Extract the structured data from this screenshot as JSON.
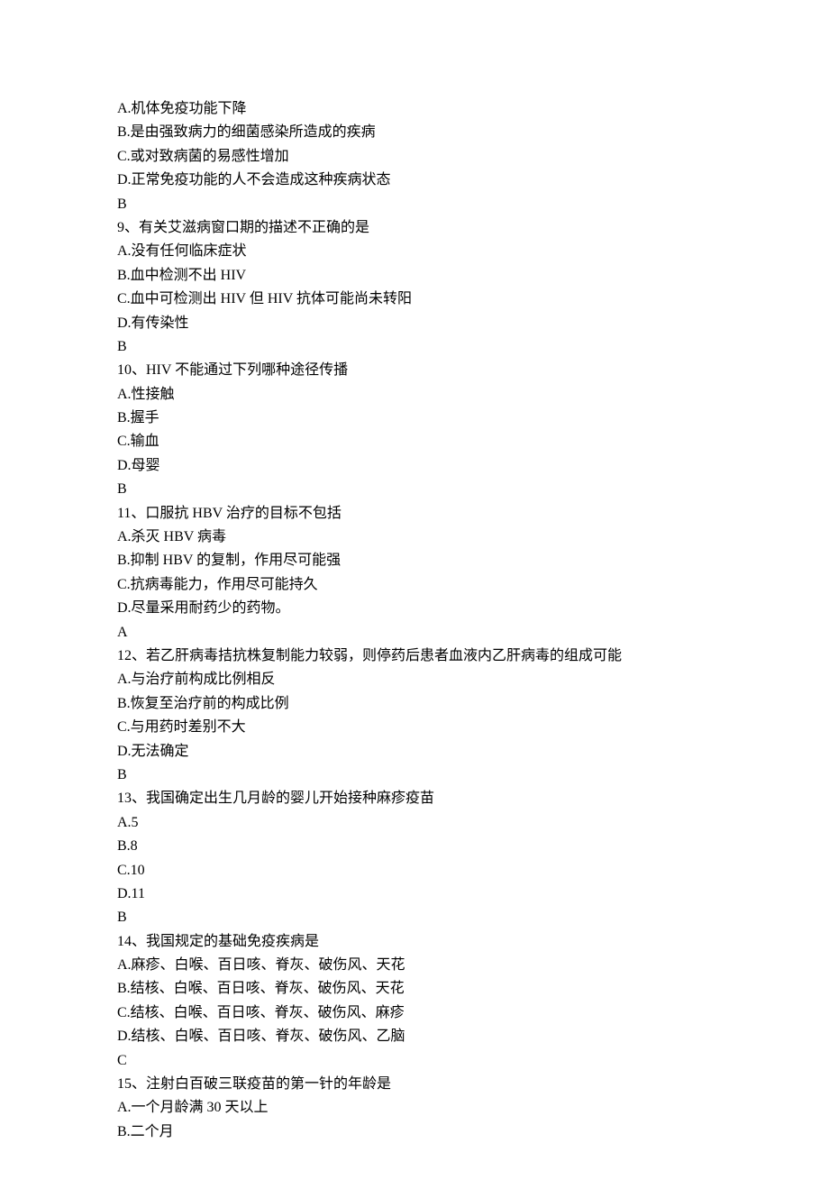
{
  "lines": [
    "A.机体免疫功能下降",
    "B.是由强致病力的细菌感染所造成的疾病",
    "C.或对致病菌的易感性增加",
    "D.正常免疫功能的人不会造成这种疾病状态",
    "B",
    "9、有关艾滋病窗口期的描述不正确的是",
    "A.没有任何临床症状",
    "B.血中检测不出 HIV",
    "C.血中可检测出 HIV 但 HIV 抗体可能尚未转阳",
    "D.有传染性",
    "B",
    "10、HIV 不能通过下列哪种途径传播",
    "A.性接触",
    "B.握手",
    "C.输血",
    "D.母婴",
    "B",
    "11、口服抗 HBV 治疗的目标不包括",
    "A.杀灭 HBV 病毒",
    "B.抑制 HBV 的复制，作用尽可能强",
    "C.抗病毒能力，作用尽可能持久",
    "D.尽量采用耐药少的药物。",
    "A",
    "12、若乙肝病毒拮抗株复制能力较弱，则停药后患者血液内乙肝病毒的组成可能",
    "A.与治疗前构成比例相反",
    "B.恢复至治疗前的构成比例",
    "C.与用药时差别不大",
    "D.无法确定",
    "B",
    "13、我国确定出生几月龄的婴儿开始接种麻疹疫苗",
    "A.5",
    "B.8",
    "C.10",
    "D.11",
    "B",
    "14、我国规定的基础免疫疾病是",
    "A.麻疹、白喉、百日咳、脊灰、破伤风、天花",
    "B.结核、白喉、百日咳、脊灰、破伤风、天花",
    "C.结核、白喉、百日咳、脊灰、破伤风、麻疹",
    "D.结核、白喉、百日咳、脊灰、破伤风、乙脑",
    "C",
    "15、注射白百破三联疫苗的第一针的年龄是",
    "A.一个月龄满 30 天以上",
    "B.二个月"
  ]
}
